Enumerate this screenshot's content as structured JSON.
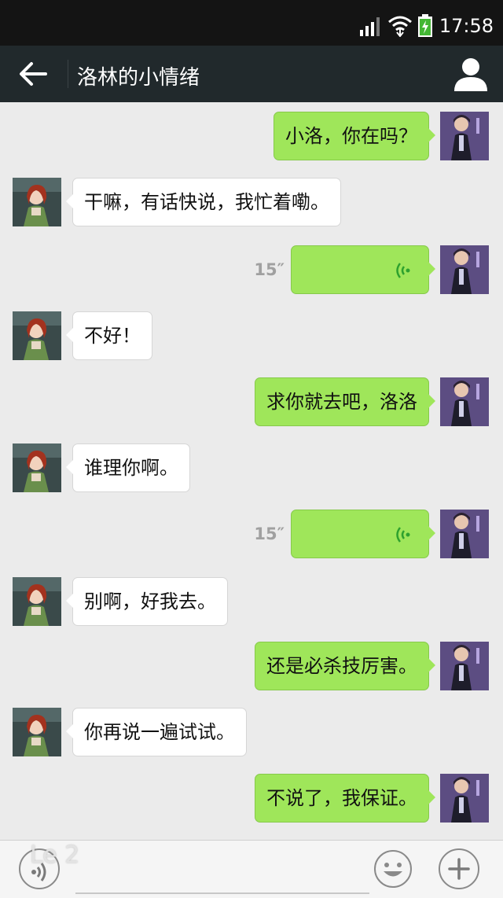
{
  "status_bar": {
    "time": "17:58"
  },
  "header": {
    "title": "洛林的小情绪"
  },
  "messages": [
    {
      "side": "right",
      "type": "text",
      "text": "小洛，你在吗？"
    },
    {
      "side": "left",
      "type": "text",
      "text": "干嘛，有话快说，我忙着嘞。"
    },
    {
      "side": "right",
      "type": "voice",
      "duration": "15″"
    },
    {
      "side": "left",
      "type": "text",
      "text": "不好！"
    },
    {
      "side": "right",
      "type": "text",
      "text": "求你就去吧，洛洛"
    },
    {
      "side": "left",
      "type": "text",
      "text": "谁理你啊。"
    },
    {
      "side": "right",
      "type": "voice",
      "duration": "15″"
    },
    {
      "side": "left",
      "type": "text",
      "text": "别啊，好我去。"
    },
    {
      "side": "right",
      "type": "text",
      "text": "还是必杀技厉害。"
    },
    {
      "side": "left",
      "type": "text",
      "text": "你再说一遍试试。"
    },
    {
      "side": "right",
      "type": "text",
      "text": "不说了，我保证。"
    }
  ],
  "input_bar": {
    "value": "",
    "placeholder": ""
  },
  "watermark": "Le 2",
  "colors": {
    "outgoing_bubble": "#9fe65a",
    "incoming_bubble": "#ffffff",
    "header": "#21292c",
    "voice_wave": "#2ea12e"
  },
  "icons": [
    "back-arrow-icon",
    "profile-icon",
    "signal-icon",
    "wifi-icon",
    "battery-icon",
    "voice-mode-icon",
    "emoji-icon",
    "plus-icon",
    "voice-wave-icon"
  ]
}
